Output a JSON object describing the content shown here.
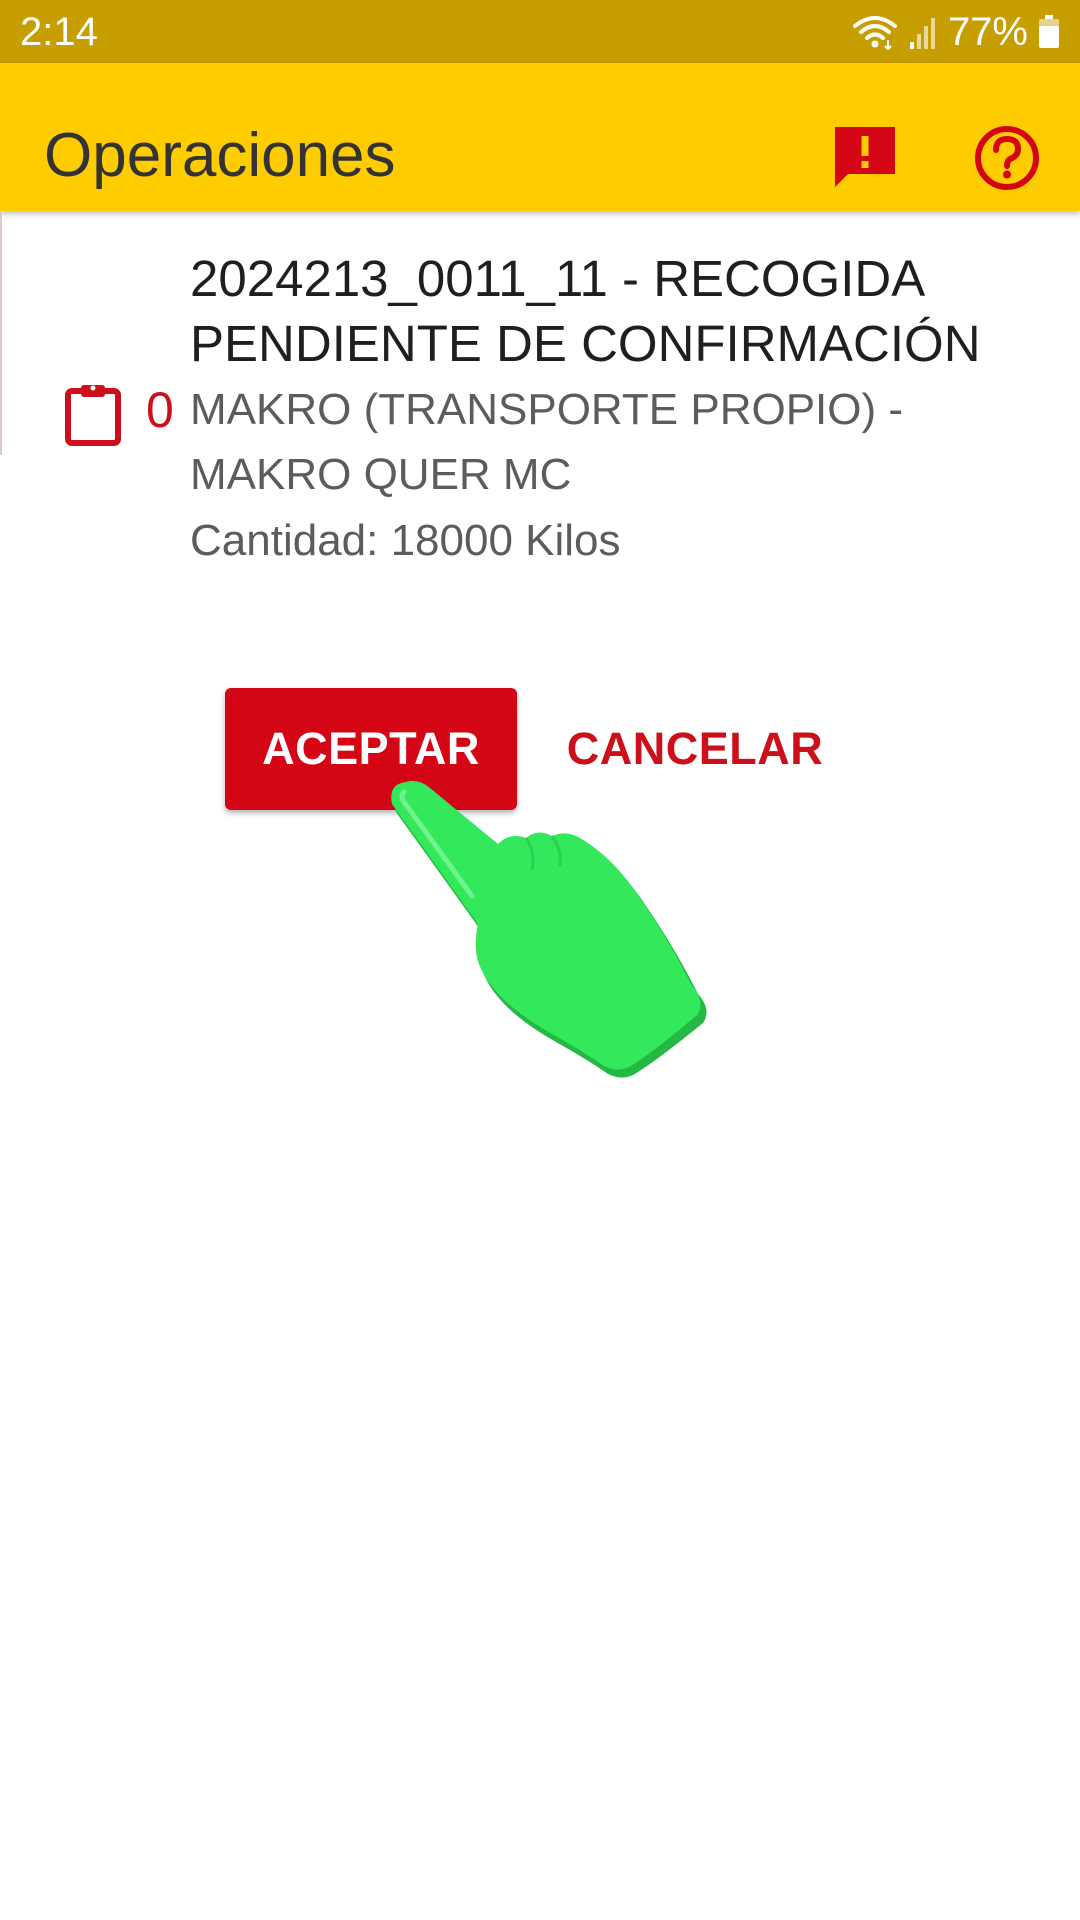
{
  "status_bar": {
    "time": "2:14",
    "battery": "77%",
    "icons": [
      "wifi-icon",
      "signal-icon",
      "battery-icon"
    ]
  },
  "app_bar": {
    "title": "Operaciones",
    "icons": [
      "report-alert-icon",
      "help-icon"
    ]
  },
  "operation": {
    "title": "2024213_0011_11 - RECOGIDA PENDIENTE DE CONFIRMACIÓN",
    "count": "0",
    "company": "MAKRO (TRANSPORTE PROPIO) - MAKRO QUER MC",
    "quantity": "Cantidad: 18000 Kilos",
    "icon": "clipboard-icon"
  },
  "actions": {
    "accept_label": "ACEPTAR",
    "cancel_label": "CANCELAR"
  },
  "overlay": {
    "icon": "hand-pointer-icon"
  },
  "colors": {
    "status_bar": "#c79e00",
    "app_bar": "#ffcc00",
    "accent_red": "#d40615",
    "text_dark": "#1f1f1f",
    "text_secondary": "#5c5c5c",
    "hand_green": "#33e85a"
  }
}
